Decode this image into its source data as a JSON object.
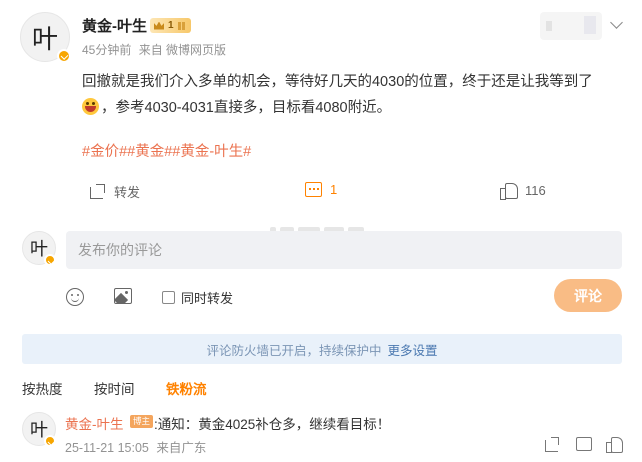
{
  "post": {
    "author": "黄金-叶生",
    "vip_level": "1",
    "time": "45分钟前",
    "source": "来自 微博网页版",
    "text": "回撤就是我们介入多单的机会，等待好几天的4030的位置，终于还是让我等到了",
    "text_after_emoji": "，参考4030-4031直接多，目标看4080附近。",
    "emoji": "laughing-emoji",
    "tags": [
      "#金价#",
      "#黄金#",
      "#黄金-叶生#"
    ],
    "avatar_glyph": "叶"
  },
  "actions": {
    "share_label": "转发",
    "comment_count": "1",
    "like_count": "116"
  },
  "composer": {
    "placeholder": "发布你的评论",
    "repost_label": "同时转发",
    "submit_label": "评论"
  },
  "notice": {
    "text": "评论防火墙已开启，持续保护中",
    "link": "更多设置"
  },
  "sort_tabs": [
    {
      "label": "按热度",
      "active": false
    },
    {
      "label": "按时间",
      "active": false
    },
    {
      "label": "铁粉流",
      "active": true
    }
  ],
  "comment": {
    "author": "黄金-叶生",
    "badge": "博主",
    "text": ":通知：黄金4025补仓多，继续看目标！",
    "datetime": "25-11-21 15:05",
    "location": "来自广东"
  },
  "colors": {
    "accent": "#ff8200",
    "link": "#eb7350",
    "verified": "#f7a600"
  }
}
